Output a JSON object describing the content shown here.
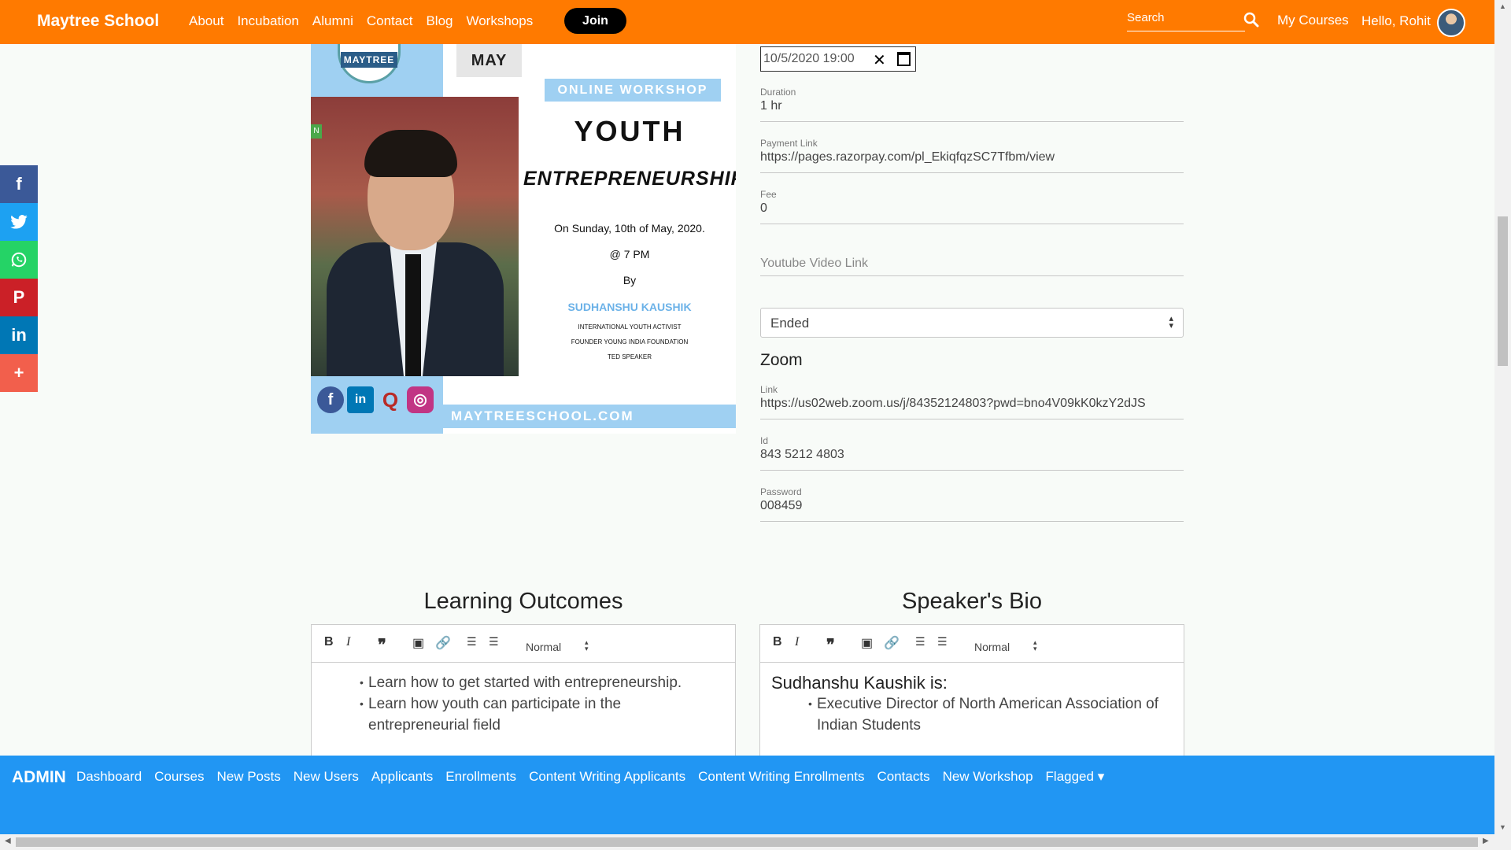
{
  "topnav": {
    "brand": "Maytree School",
    "links": [
      "About",
      "Incubation",
      "Alumni",
      "Contact",
      "Blog",
      "Workshops"
    ],
    "join": "Join",
    "search_placeholder": "Search",
    "my_courses": "My Courses",
    "greeting": "Hello, Rohit"
  },
  "share": [
    "facebook-icon",
    "twitter-icon",
    "whatsapp-icon",
    "pinterest-icon",
    "linkedin-icon",
    "plus-icon"
  ],
  "poster": {
    "logo_text": "MAYTREE",
    "date_partial": "10",
    "month": "MAY",
    "badge": "ONLINE WORKSHOP",
    "title1": "YOUTH",
    "title2": "ENTREPRENEURSHIP",
    "when": "On Sunday, 10th of May, 2020.",
    "time": "@ 7 PM",
    "by": "By",
    "speaker": "SUDHANSHU KAUSHIK",
    "role1": "INTERNATIONAL YOUTH ACTIVIST",
    "role2": "FOUNDER YOUNG INDIA FOUNDATION",
    "role3": "TED SPEAKER",
    "url": "MAYTREESCHOOL.COM",
    "photo_tag": "N"
  },
  "form": {
    "datetime": "10/5/2020 19:00",
    "duration_label": "Duration",
    "duration": "1 hr",
    "payment_label": "Payment Link",
    "payment": "https://pages.razorpay.com/pl_EkiqfqzSC7Tfbm/view",
    "fee_label": "Fee",
    "fee": "0",
    "youtube_placeholder": "Youtube Video Link",
    "status": "Ended",
    "zoom_heading": "Zoom",
    "zoom_link_label": "Link",
    "zoom_link": "https://us02web.zoom.us/j/84352124803?pwd=bno4V09kK0kzY2dJS",
    "zoom_id_label": "Id",
    "zoom_id": "843 5212 4803",
    "zoom_password_label": "Password",
    "zoom_password": "008459"
  },
  "editors": {
    "learning_title": "Learning Outcomes",
    "bio_title": "Speaker's Bio",
    "normal": "Normal",
    "learning_items": [
      "Learn how to get started with entrepreneurship.",
      "Learn how youth can participate in the entrepreneurial field"
    ],
    "bio_heading": "Sudhanshu Kaushik is:",
    "bio_items": [
      "Executive Director of North American Association of Indian Students"
    ]
  },
  "admin": {
    "title": "ADMIN",
    "links": [
      "Dashboard",
      "Courses",
      "New Posts",
      "New Users",
      "Applicants",
      "Enrollments",
      "Content Writing Applicants",
      "Content Writing Enrollments",
      "Contacts",
      "New Workshop",
      "Flagged ▾"
    ]
  }
}
